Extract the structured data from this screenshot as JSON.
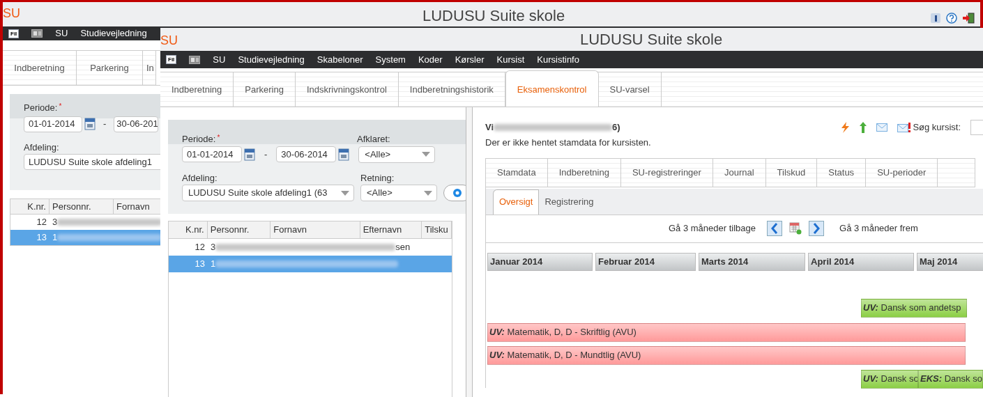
{
  "back_window": {
    "logo": "SU",
    "title": "LUDUSU Suite skole",
    "menu": [
      {
        "kind": "file",
        "label": "Fil"
      },
      {
        "kind": "doc"
      },
      {
        "kind": "text",
        "label": "SU"
      },
      {
        "kind": "text",
        "label": "Studievejledning"
      }
    ],
    "tabs": [
      {
        "label": "Indberetning",
        "selected": false
      },
      {
        "label": "Parkering",
        "selected": false
      },
      {
        "label": "In",
        "selected": false
      }
    ],
    "filter": {
      "periode_label": "Periode:",
      "required_mark": "*",
      "from": "01-01-2014",
      "separator": "-",
      "to": "30-06-201",
      "afdeling_label": "Afdeling:",
      "afdeling": "LUDUSU Suite skole afdeling1"
    },
    "table": {
      "columns": [
        "K.nr.",
        "Personnr.",
        "Fornavn"
      ],
      "rows": [
        {
          "knr": "12",
          "personnr": "3",
          "selected": false
        },
        {
          "knr": "13",
          "personnr": "1",
          "selected": true
        }
      ]
    }
  },
  "front_window": {
    "logo": "SU",
    "title": "LUDUSU Suite skole",
    "menu": [
      {
        "kind": "file",
        "label": "Fil"
      },
      {
        "kind": "doc"
      },
      {
        "kind": "text",
        "label": "SU"
      },
      {
        "kind": "text",
        "label": "Studievejledning"
      },
      {
        "kind": "text",
        "label": "Skabeloner"
      },
      {
        "kind": "text",
        "label": "System"
      },
      {
        "kind": "text",
        "label": "Koder"
      },
      {
        "kind": "text",
        "label": "Kørsler"
      },
      {
        "kind": "text",
        "label": "Kursist"
      },
      {
        "kind": "text",
        "label": "Kursistinfo"
      }
    ],
    "tabs": [
      {
        "label": "Indberetning",
        "selected": false
      },
      {
        "label": "Parkering",
        "selected": false
      },
      {
        "label": "Indskrivningskontrol",
        "selected": false
      },
      {
        "label": "Indberetningshistorik",
        "selected": false
      },
      {
        "label": "Eksamenskontrol",
        "selected": true
      },
      {
        "label": "SU-varsel",
        "selected": false
      }
    ],
    "filter": {
      "periode_label": "Periode:",
      "required_mark": "*",
      "from": "01-01-2014",
      "separator": "-",
      "to": "30-06-2014",
      "afklaret_label": "Afklaret:",
      "afklaret": "<Alle>",
      "afdeling_label": "Afdeling:",
      "afdeling": "LUDUSU Suite skole afdeling1 (63",
      "retning_label": "Retning:",
      "retning": "<Alle>"
    },
    "table": {
      "columns": [
        "K.nr.",
        "Personnr.",
        "Fornavn",
        "Efternavn",
        "Tilsku"
      ],
      "rows": [
        {
          "knr": "12",
          "personnr": "3",
          "efternavn": "sen",
          "selected": false
        },
        {
          "knr": "13",
          "personnr": "1",
          "selected": true
        }
      ]
    },
    "student": {
      "name_start": "Vi",
      "name_end": "6)",
      "search_label": "Søg kursist:",
      "message": "Der er ikke hentet stamdata for kursisten."
    },
    "detail_tabs": [
      {
        "label": "Stamdata",
        "selected": false
      },
      {
        "label": "Indberetning",
        "selected": false
      },
      {
        "label": "SU-registreringer",
        "selected": false
      },
      {
        "label": "Journal",
        "selected": false
      },
      {
        "label": "Tilskud",
        "selected": false
      },
      {
        "label": "Status",
        "selected": false
      },
      {
        "label": "SU-perioder",
        "selected": false
      }
    ],
    "sub_tabs": [
      {
        "label": "Oversigt",
        "selected": true
      },
      {
        "label": "Registrering",
        "selected": false
      }
    ],
    "nav": {
      "back": "Gå 3 måneder tilbage",
      "forward": "Gå 3 måneder frem"
    },
    "months": [
      "Januar 2014",
      "Februar 2014",
      "Marts 2014",
      "April 2014",
      "Maj 2014"
    ],
    "bars": [
      {
        "prefix": "UV:",
        "text": "Dansk som andetsp",
        "color": "#8ccf45"
      },
      {
        "prefix": "UV:",
        "text": "Matematik, D, D - Skriftlig (AVU)",
        "color": "#ff9a9a"
      },
      {
        "prefix": "UV:",
        "text": "Matematik, D, D - Mundtlig (AVU)",
        "color": "#ff9a9a"
      },
      {
        "prefix": "UV:",
        "text": "Dansk so",
        "color": "#8ccf45"
      },
      {
        "prefix": "EKS:",
        "text": "Dansk so",
        "color": "#8ccf45"
      }
    ]
  }
}
